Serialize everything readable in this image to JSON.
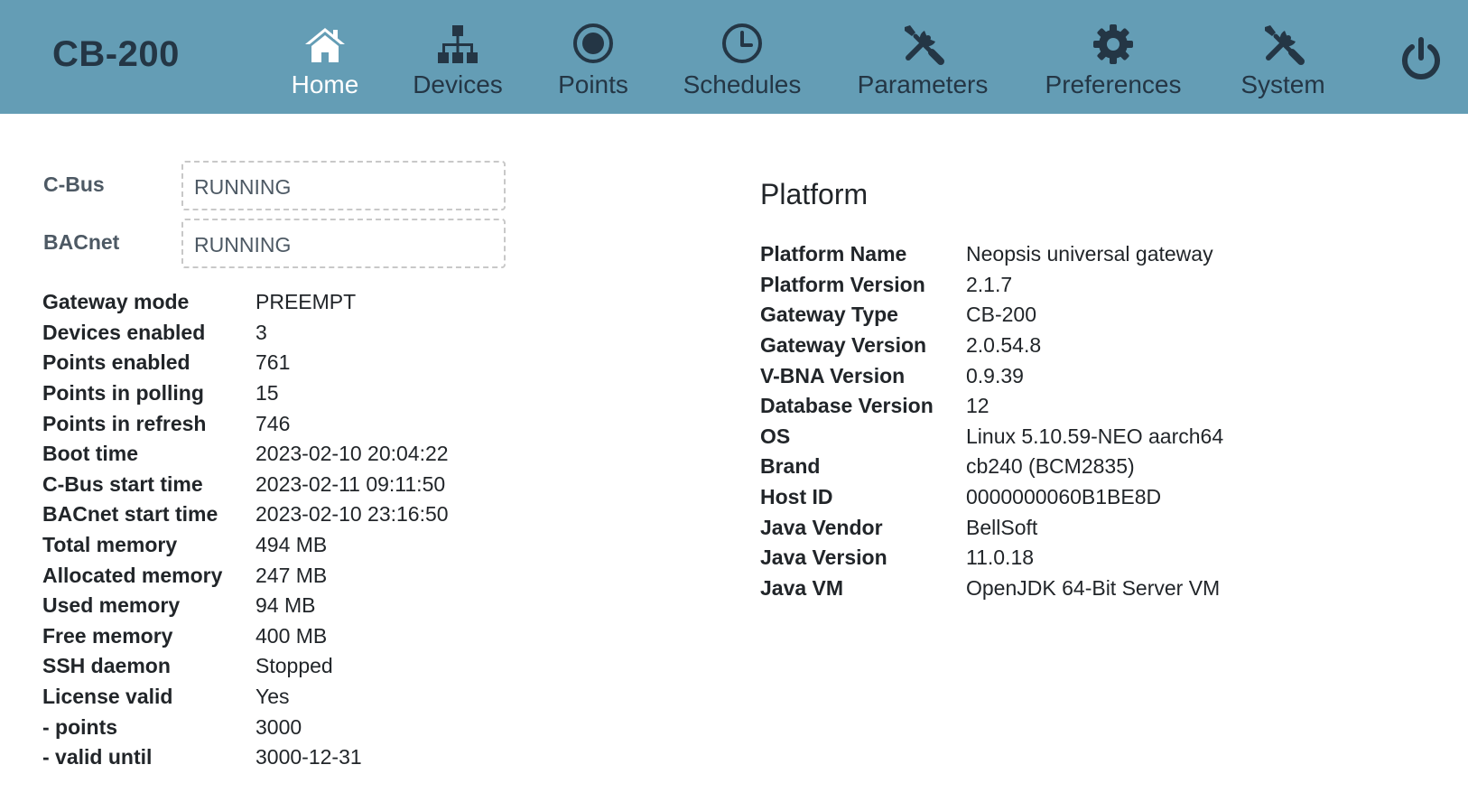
{
  "app": {
    "brand": "CB-200"
  },
  "nav": [
    {
      "label": "Home",
      "icon": "home-icon",
      "active": true
    },
    {
      "label": "Devices",
      "icon": "sitemap-icon"
    },
    {
      "label": "Points",
      "icon": "dot-circle-icon"
    },
    {
      "label": "Schedules",
      "icon": "clock-icon"
    },
    {
      "label": "Parameters",
      "icon": "tools-icon"
    },
    {
      "label": "Preferences",
      "icon": "gear-icon"
    },
    {
      "label": "System",
      "icon": "tools-icon"
    }
  ],
  "power": {
    "icon": "power-icon"
  },
  "status": [
    {
      "label": "C-Bus",
      "value": "RUNNING"
    },
    {
      "label": "BACnet",
      "value": "RUNNING"
    }
  ],
  "gateway": [
    {
      "key": "Gateway mode",
      "value": "PREEMPT"
    },
    {
      "key": "Devices enabled",
      "value": "3"
    },
    {
      "key": "Points enabled",
      "value": "761"
    },
    {
      "key": "Points in polling",
      "value": "15"
    },
    {
      "key": "Points in refresh",
      "value": "746"
    },
    {
      "key": "Boot time",
      "value": "2023-02-10 20:04:22"
    },
    {
      "key": "C-Bus start time",
      "value": "2023-02-11 09:11:50"
    },
    {
      "key": "BACnet start time",
      "value": "2023-02-10 23:16:50"
    },
    {
      "key": "Total memory",
      "value": "494 MB"
    },
    {
      "key": "Allocated memory",
      "value": "247 MB"
    },
    {
      "key": "Used memory",
      "value": "94 MB"
    },
    {
      "key": "Free memory",
      "value": "400 MB"
    },
    {
      "key": "SSH daemon",
      "value": "Stopped"
    },
    {
      "key": "License valid",
      "value": "Yes"
    },
    {
      "key": "- points",
      "value": "3000"
    },
    {
      "key": "- valid until",
      "value": "3000-12-31"
    }
  ],
  "platform": {
    "title": "Platform",
    "rows": [
      {
        "key": "Platform Name",
        "value": "Neopsis universal gateway"
      },
      {
        "key": "Platform Version",
        "value": "2.1.7"
      },
      {
        "key": "Gateway Type",
        "value": "CB-200"
      },
      {
        "key": "Gateway Version",
        "value": "2.0.54.8"
      },
      {
        "key": "V-BNA Version",
        "value": "0.9.39"
      },
      {
        "key": "Database Version",
        "value": "12"
      },
      {
        "key": "OS",
        "value": "Linux 5.10.59-NEO aarch64"
      },
      {
        "key": "Brand",
        "value": "cb240 (BCM2835)"
      },
      {
        "key": "Host ID",
        "value": "0000000060B1BE8D"
      },
      {
        "key": "Java Vendor",
        "value": "BellSoft"
      },
      {
        "key": "Java Version",
        "value": "11.0.18"
      },
      {
        "key": "Java VM",
        "value": "OpenJDK 64-Bit Server VM"
      }
    ]
  },
  "colors": {
    "header_bg": "#649db5",
    "header_text": "#243645",
    "active_nav": "#ffffff"
  }
}
